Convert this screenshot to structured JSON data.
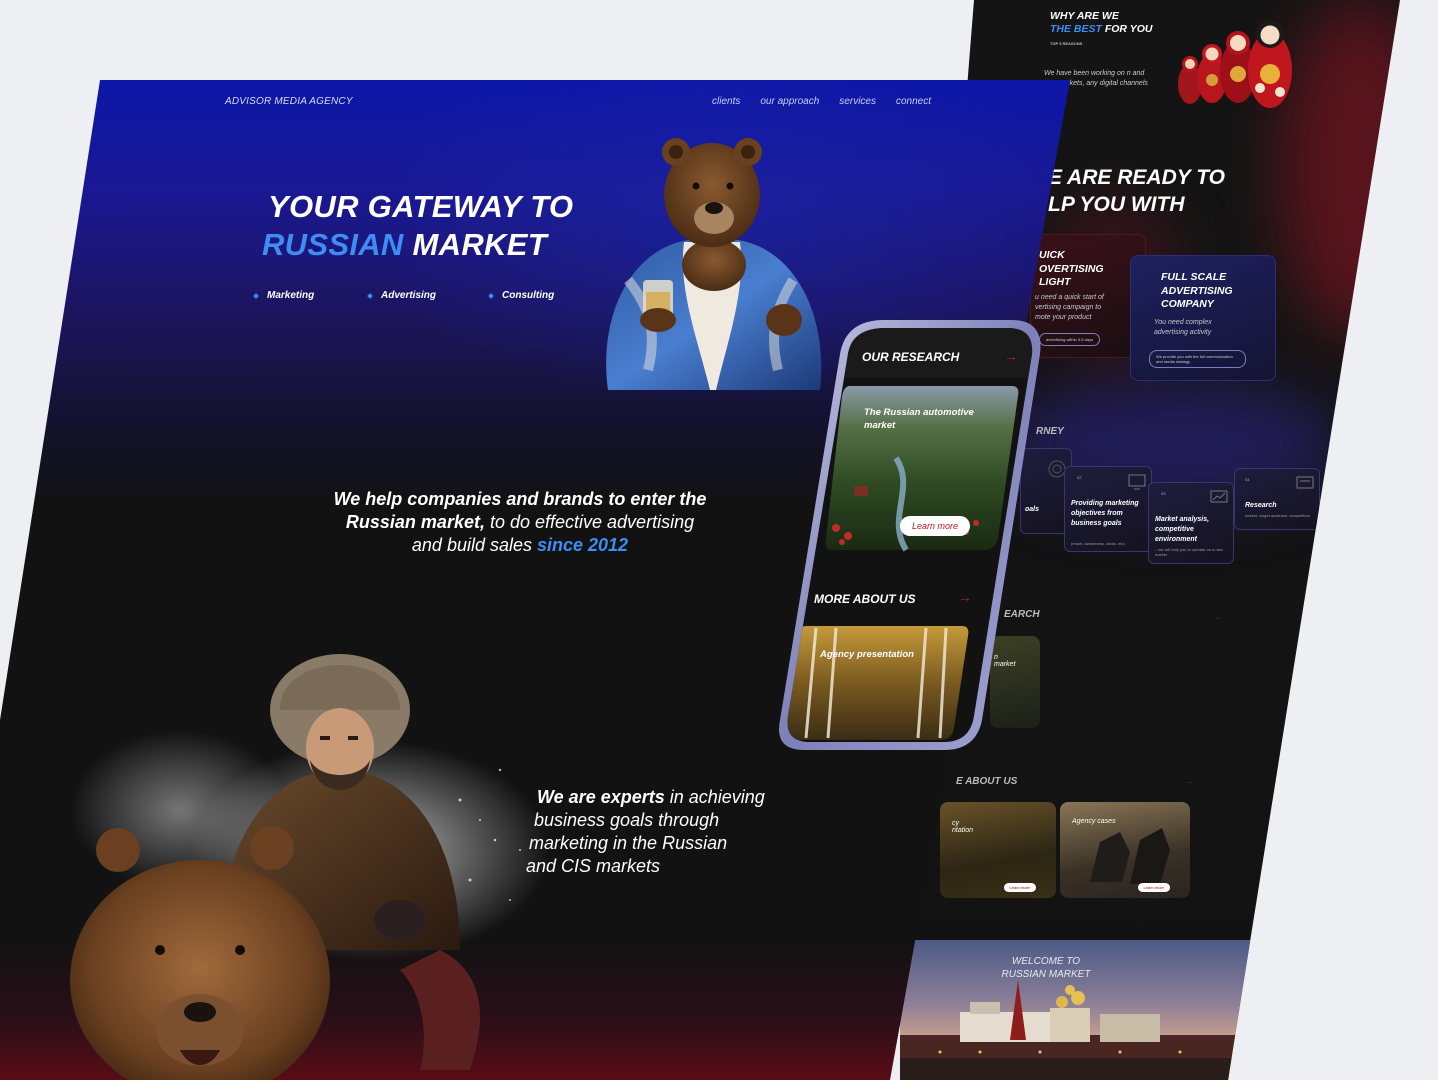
{
  "nav": {
    "brand": "ADVISOR MEDIA AGENCY",
    "links": [
      "clients",
      "our approach",
      "services",
      "connect"
    ]
  },
  "hero": {
    "title_line1": "YOUR GATEWAY TO",
    "title_accent": "RUSSIAN",
    "title_rest": " MARKET",
    "tags": [
      "Marketing",
      "Advertising",
      "Consulting"
    ]
  },
  "intro": {
    "bold1": "We help companies and brands to enter the",
    "bold2": "Russian market,",
    "plain1": " to do effective advertising",
    "plain2": "and build sales ",
    "accent": "since 2012"
  },
  "experts": {
    "bold": "We are experts",
    "line1": " in achieving",
    "line2": "business goals through",
    "line3": "marketing in the Russian",
    "line4": "and CIS markets"
  },
  "phone": {
    "research_title": "OUR RESEARCH",
    "research_card": "The Russian automotive market",
    "learn_more": "Learn more",
    "about_title": "MORE ABOUT US",
    "about_card": "Agency presentation"
  },
  "right": {
    "why_line1": "WHY ARE WE",
    "why_accent": "THE BEST",
    "why_rest": " FOR YOU",
    "why_sub": "TOP 5 REASONS",
    "why_body": "We have been working on n and CIS markets, any digital channels",
    "ready_line1": "E ARE READY TO",
    "ready_line2": "LP YOU WITH",
    "card1_title": "UICK\nOVERTISING\nLIGHT",
    "card1_text": "u need a quick start of\nvertising campaign to\nmote your product",
    "card1_pill": "advertising within 3-5 days",
    "card2_title": "FULL SCALE\nADVERTISING\nCOMPANY",
    "card2_text": "You need complex\nadvertising activity",
    "card2_pill": "We provide you with the full communication and media strategy",
    "journey_label": "RNEY",
    "journey": [
      {
        "num": "02",
        "title": "Providing marketing objectives from business goals",
        "text": "(reach, awareness, clicks, etc)"
      },
      {
        "num": "03",
        "title": "Market analysis, competitive environment",
        "text": "– we will help you to operate on a new market"
      },
      {
        "num": "04",
        "title": "Research",
        "text": "market, target audience, competitors"
      }
    ],
    "journey_partial": "oals",
    "research_label": "EARCH",
    "research_partial": "n\nmarket",
    "about_label": "E ABOUT US",
    "about_card1": "cy\nntation",
    "about_card2": "Agency cases",
    "learn_more_small": "Learn more",
    "welcome": "WELCOME TO\nRUSSIAN MARKET"
  },
  "colors": {
    "accent_blue": "#3d8df2",
    "accent_red": "#c21a1a",
    "bg_dark": "#121212",
    "hero_blue": "#0c17a8"
  }
}
